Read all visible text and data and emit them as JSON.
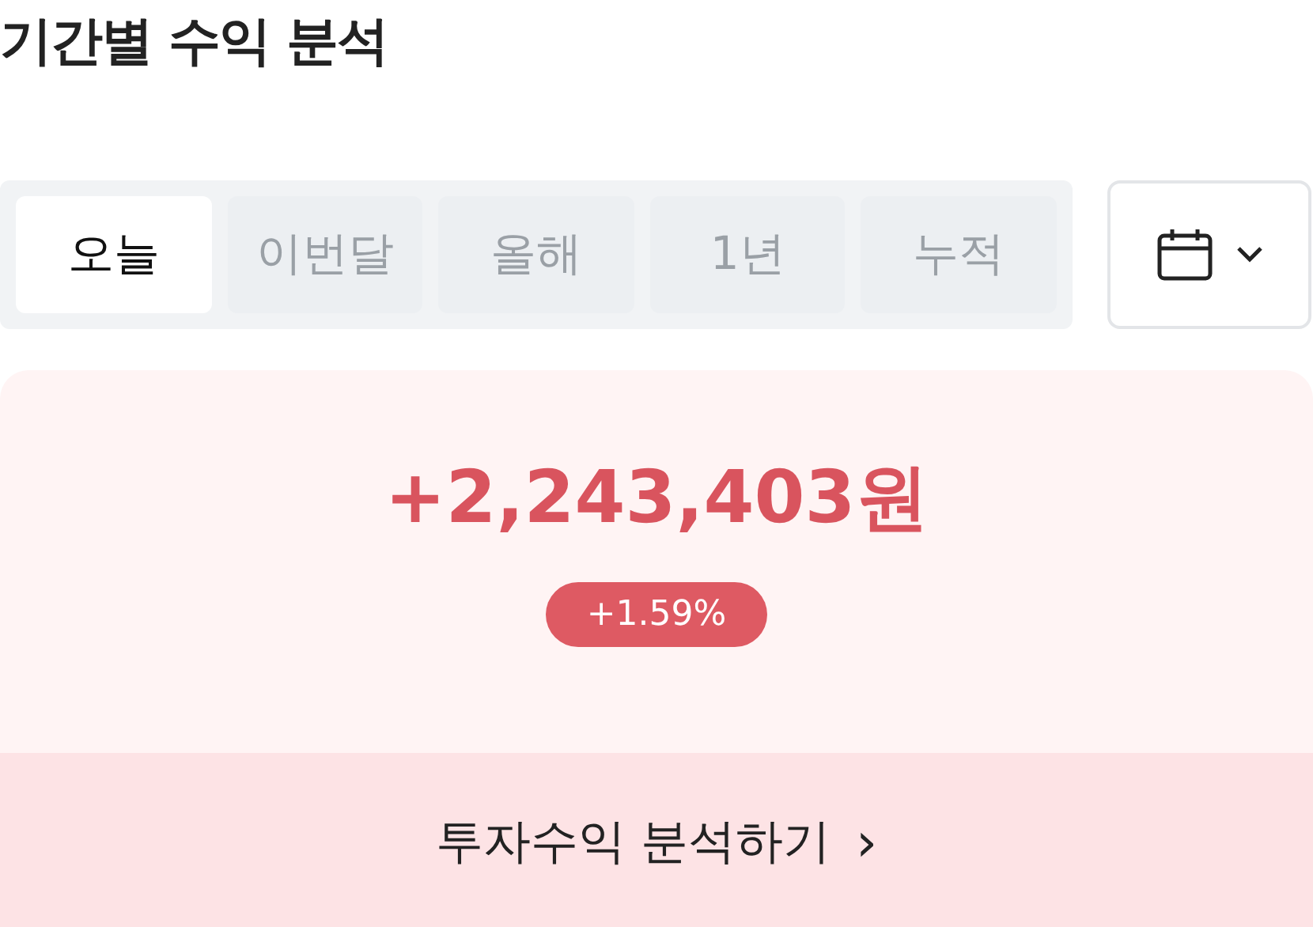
{
  "title": "기간별 수익 분석",
  "tabs": [
    {
      "label": "오늘",
      "selected": true
    },
    {
      "label": "이번달",
      "selected": false
    },
    {
      "label": "올해",
      "selected": false
    },
    {
      "label": "1년",
      "selected": false
    },
    {
      "label": "누적",
      "selected": false
    }
  ],
  "summary": {
    "amount": "+2,243,403원",
    "rate": "+1.59%"
  },
  "action": {
    "label": "투자수익 분석하기",
    "arrow": "›"
  }
}
